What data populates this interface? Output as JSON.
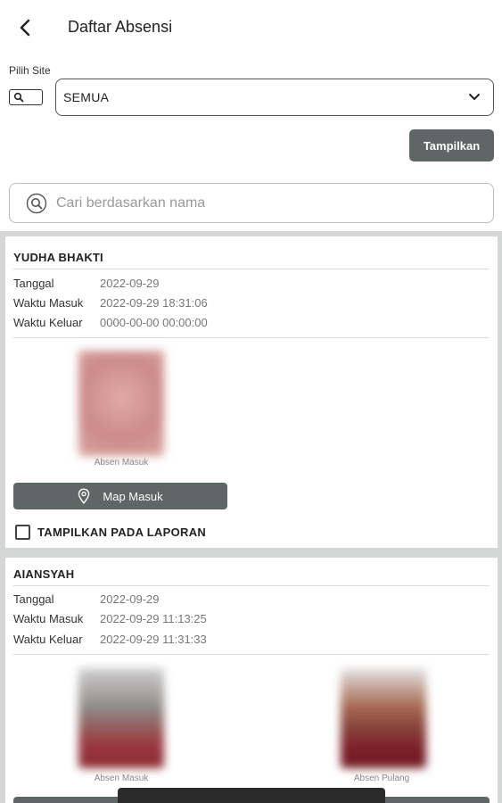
{
  "header": {
    "title": "Daftar Absensi"
  },
  "filter": {
    "site_label": "Pilih Site",
    "site_value": "SEMUA",
    "show_button": "Tampilkan",
    "search_placeholder": "Cari berdasarkan nama"
  },
  "labels": {
    "date": "Tanggal",
    "time_in": "Waktu Masuk",
    "time_out": "Waktu Keluar",
    "photo_in": "Absen Masuk",
    "photo_out": "Absen Pulang",
    "map_in": "Map Masuk",
    "show_in_report": "TAMPILKAN PADA LAPORAN"
  },
  "records": [
    {
      "name": "YUDHA BHAKTI",
      "date": "2022-09-29",
      "time_in": "2022-09-29 18:31:06",
      "time_out": "0000-00-00 00:00:00"
    },
    {
      "name": "AIANSYAH",
      "date": "2022-09-29",
      "time_in": "2022-09-29 11:13:25",
      "time_out": "2022-09-29 11:31:33"
    }
  ],
  "colors": {
    "button_bg": "#5f6665",
    "list_bg": "#d4d7d6",
    "value_text": "#777777"
  },
  "icons": {
    "back": "arrow-left-icon",
    "site": "search-icon",
    "dropdown": "chevron-down-icon",
    "search": "search-icon",
    "map": "location-pin-icon"
  }
}
